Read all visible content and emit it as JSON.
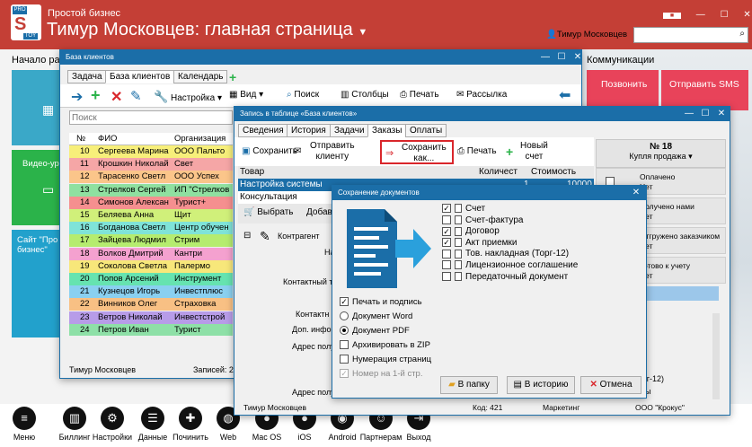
{
  "app": {
    "logo_top": "PRO",
    "logo_bottom": "TOY",
    "small_title": "Простой бизнес",
    "title": "Тимур Московцев: главная страница",
    "user": "Тимур Московцев",
    "nav_left": "Начало ра",
    "nav_right": "Коммуникации",
    "tiles_left": [
      "Видео-ур",
      "Сайт \"Про\nбизнес\""
    ],
    "tiles_right": [
      "Позвонить",
      "Отправить SMS"
    ]
  },
  "bottom_bar": [
    "Меню",
    "Биллинг",
    "Настройки",
    "Данные",
    "Починить",
    "Web",
    "Mac OS",
    "iOS",
    "Android",
    "Партнерам",
    "Выход"
  ],
  "clients_window": {
    "title": "База клиентов",
    "tabs": [
      "Задача",
      "База клиентов",
      "Календарь"
    ],
    "toolbar": {
      "settings": "Настройка",
      "view": "Вид",
      "search": "Поиск",
      "columns": "Столбцы",
      "print": "Печать",
      "mailing": "Рассылка"
    },
    "search_placeholder": "Поиск",
    "columns": [
      "№",
      "ФИО",
      "Организация"
    ],
    "rows": [
      {
        "n": "10",
        "fio": "Сергеева Марина",
        "org": "ООО Пальто",
        "color": "#f7ef7a"
      },
      {
        "n": "11",
        "fio": "Крошкин Николай",
        "org": "Свет",
        "color": "#f5a6a6"
      },
      {
        "n": "12",
        "fio": "Тарасенко Светл",
        "org": "ООО Успех",
        "color": "#fbc58a"
      },
      {
        "n": "13",
        "fio": "Стрелков Сергей",
        "org": "ИП \"Стрелков",
        "color": "#8fe0a0"
      },
      {
        "n": "14",
        "fio": "Симонов Алексан",
        "org": "Турист+",
        "color": "#f58f8f"
      },
      {
        "n": "15",
        "fio": "Беляева Анна",
        "org": "Щит",
        "color": "#d0f07a"
      },
      {
        "n": "16",
        "fio": "Богданова Светл",
        "org": "Центр обучен",
        "color": "#7fe3d8"
      },
      {
        "n": "17",
        "fio": "Зайцева Людмил",
        "org": "Стрим",
        "color": "#b5ec6f"
      },
      {
        "n": "18",
        "fio": "Волков Дмитрий",
        "org": "Кантри",
        "color": "#f4a1cf"
      },
      {
        "n": "19",
        "fio": "Соколова Светла",
        "org": "Палермо",
        "color": "#f7e77a"
      },
      {
        "n": "20",
        "fio": "Попов Арсений",
        "org": "Инструмент",
        "color": "#66e3b0"
      },
      {
        "n": "21",
        "fio": "Кузнецов Игорь",
        "org": "Инвестплюс",
        "color": "#8ad0f0"
      },
      {
        "n": "22",
        "fio": "Винников Олег",
        "org": "Страховка",
        "color": "#f8c084"
      },
      {
        "n": "23",
        "fio": "Ветров Николай",
        "org": "Инвестстрой",
        "color": "#b79ce8"
      },
      {
        "n": "24",
        "fio": "Петров Иван",
        "org": "Турист",
        "color": "#8ee0a7"
      }
    ],
    "status_user": "Тимур Московцев",
    "status_count": "Записей: 2"
  },
  "record_window": {
    "title": "Запись в таблице «База клиентов»",
    "tabs": [
      "Сведения",
      "История",
      "Задачи",
      "Заказы",
      "Оплаты"
    ],
    "toolbar": {
      "save": "Сохранить",
      "send": "Отправить\nклиенту",
      "save_as": "Сохранить\nкак...",
      "print": "Печать",
      "new_invoice": "Новый\nсчет"
    },
    "order_no": "№ 18",
    "order_type": "Купля продажа",
    "columns": [
      "Товар",
      "Количест",
      "Стоимость"
    ],
    "items": [
      {
        "name": "Настройка системы",
        "qty": "1",
        "cost": "10000"
      },
      {
        "name": "Консультация",
        "qty": "",
        "cost": ""
      }
    ],
    "pick_button": "Выбрать",
    "add_button": "Добав",
    "contragent": "Контрагент",
    "form_labels": [
      "Наи",
      "Контактный те",
      "Контактн",
      "Доп. инфор",
      "Адрес получ",
      "Адрес получ"
    ],
    "right_panel": [
      {
        "title": "Оплачено",
        "value": "Нет"
      },
      {
        "title": "Получено нами",
        "value": "Нет"
      },
      {
        "title": "Отгружено заказчиком",
        "value": "Нет"
      },
      {
        "title": "Готово к учету",
        "value": "Нет"
      }
    ],
    "right_list": [
      "5.06.2017",
      "т-фактура",
      "вор",
      "приемки",
      "1.06.2017",
      "кладная (Торг-12)",
      "ые документы"
    ],
    "status": {
      "user": "Тимур Московцев",
      "code": "Код: 421",
      "dept": "Маркетинг",
      "company": "ООО \"Крокус\""
    }
  },
  "save_dialog": {
    "title": "Сохранение документов",
    "documents": [
      {
        "label": "Счет",
        "checked": true
      },
      {
        "label": "Счет-фактура",
        "checked": false
      },
      {
        "label": "Договор",
        "checked": true
      },
      {
        "label": "Акт приемки",
        "checked": true
      },
      {
        "label": "Тов. накладная (Торг-12)",
        "checked": false
      },
      {
        "label": "Лицензионное соглашение",
        "checked": false
      },
      {
        "label": "Передаточный документ",
        "checked": false
      }
    ],
    "options": {
      "print_sign": "Печать и подпись",
      "word": "Документ Word",
      "pdf": "Документ PDF",
      "zip": "Архивировать в ZIP",
      "numbering": "Нумерация страниц",
      "number_first": "Номер на 1-й стр."
    },
    "buttons": {
      "folder": "В папку",
      "history": "В историю",
      "cancel": "Отмена"
    }
  }
}
